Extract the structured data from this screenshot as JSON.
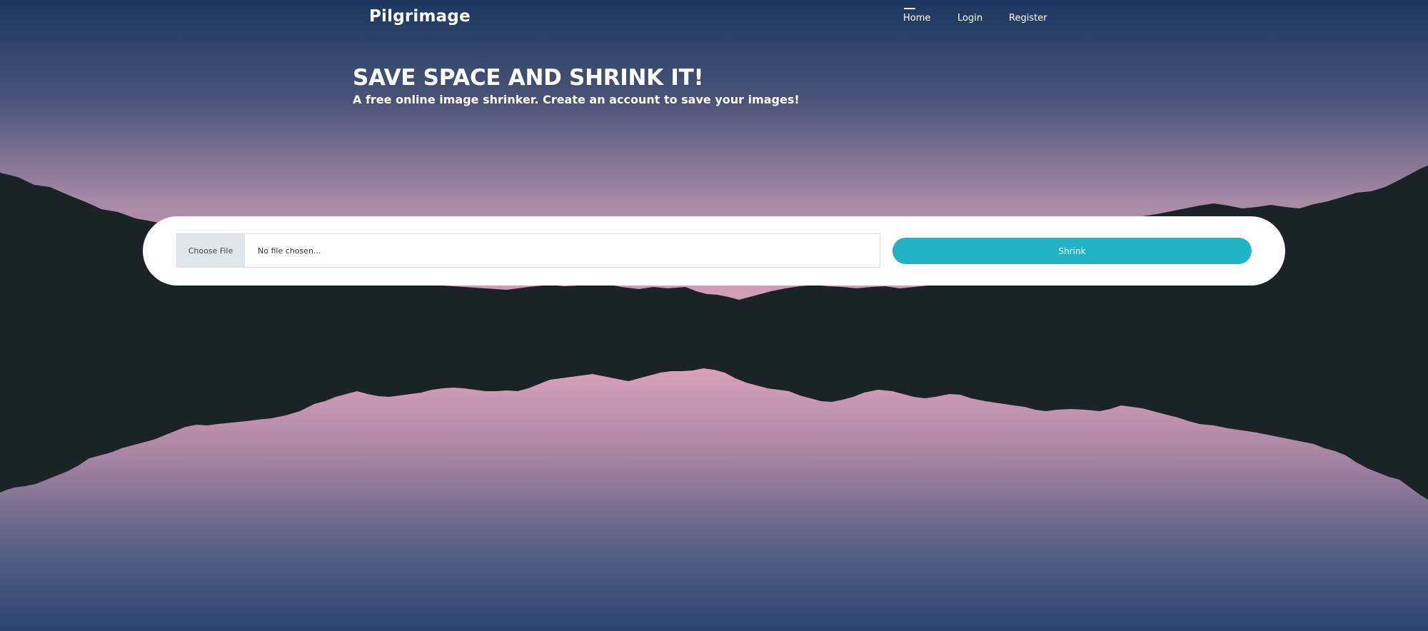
{
  "header": {
    "brand": "Pilgrimage",
    "nav": [
      {
        "label": "Home",
        "active": true
      },
      {
        "label": "Login",
        "active": false
      },
      {
        "label": "Register",
        "active": false
      }
    ]
  },
  "hero": {
    "title": "SAVE SPACE AND SHRINK IT!",
    "subtitle": "A free online image shrinker. Create an account to save your images!"
  },
  "upload": {
    "choose_file_label": "Choose File",
    "file_status": "No file chosen...",
    "submit_label": "Shrink"
  },
  "colors": {
    "accent": "#22b3c4",
    "sky_top": "#1b375f",
    "sky_pink": "#d6a1b8",
    "mountain": "#1a2425"
  }
}
